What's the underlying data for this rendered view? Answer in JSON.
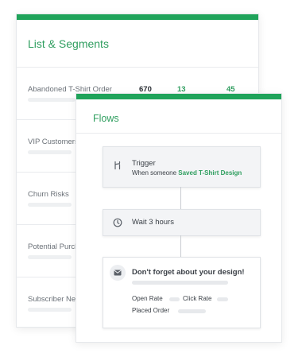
{
  "colors": {
    "accent": "#1fa35a"
  },
  "lists": {
    "title": "List & Segments",
    "rows": [
      {
        "label": "Abandoned T-Shirt Order",
        "stat1": "670",
        "stat2": "13",
        "stat3": "45"
      },
      {
        "label": "VIP Customers"
      },
      {
        "label": "Churn Risks"
      },
      {
        "label": "Potential Purchasers"
      },
      {
        "label": "Subscriber News"
      }
    ]
  },
  "flows": {
    "title": "Flows",
    "trigger": {
      "icon": "branch-icon",
      "title": "Trigger",
      "prefix": "When someone",
      "link": "Saved T-Shirt Design"
    },
    "wait": {
      "icon": "clock-icon",
      "label": "Wait 3 hours"
    },
    "email": {
      "icon": "envelope-icon",
      "title": "Don't forget about your design!",
      "open_rate_label": "Open Rate",
      "click_rate_label": "Click Rate",
      "placed_order_label": "Placed Order"
    }
  }
}
